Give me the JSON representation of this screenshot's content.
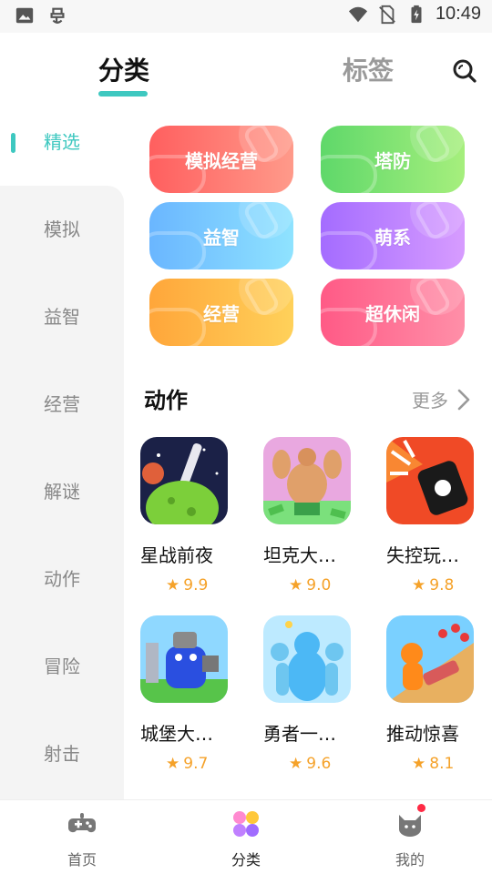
{
  "status_bar": {
    "time": "10:49",
    "left_icons": [
      "image-icon",
      "bug-icon"
    ],
    "right_icons": [
      "wifi-icon",
      "no-sim-icon",
      "battery-icon"
    ]
  },
  "header": {
    "tabs": [
      {
        "label": "分类",
        "active": true
      },
      {
        "label": "标签",
        "active": false
      }
    ],
    "search_icon": "search-icon"
  },
  "side_menu": {
    "items": [
      {
        "label": "精选",
        "active": true
      },
      {
        "label": "模拟",
        "active": false
      },
      {
        "label": "益智",
        "active": false
      },
      {
        "label": "经营",
        "active": false
      },
      {
        "label": "解谜",
        "active": false
      },
      {
        "label": "动作",
        "active": false
      },
      {
        "label": "冒险",
        "active": false
      },
      {
        "label": "射击",
        "active": false
      }
    ]
  },
  "categories": [
    {
      "label": "模拟经营",
      "colors": [
        "#ff5f5f",
        "#ff9a8a"
      ]
    },
    {
      "label": "塔防",
      "colors": [
        "#5fd86a",
        "#a6ef7d"
      ]
    },
    {
      "label": "益智",
      "colors": [
        "#6ab6ff",
        "#8fe3ff"
      ]
    },
    {
      "label": "萌系",
      "colors": [
        "#a46cff",
        "#d79cff"
      ]
    },
    {
      "label": "经营",
      "colors": [
        "#ffa63a",
        "#ffd15a"
      ]
    },
    {
      "label": "超休闲",
      "colors": [
        "#ff5a86",
        "#ff8fa8"
      ]
    }
  ],
  "section": {
    "title": "动作",
    "more_label": "更多"
  },
  "games": [
    {
      "name": "星战前夜",
      "rating": "9.9"
    },
    {
      "name": "坦克大…",
      "rating": "9.0"
    },
    {
      "name": "失控玩…",
      "rating": "9.8"
    },
    {
      "name": "城堡大…",
      "rating": "9.7"
    },
    {
      "name": "勇者一…",
      "rating": "9.6"
    },
    {
      "name": "推动惊喜",
      "rating": "8.1"
    }
  ],
  "bottom_nav": {
    "items": [
      {
        "label": "首页",
        "icon": "gamepad-icon",
        "active": false
      },
      {
        "label": "分类",
        "icon": "category-grid-icon",
        "active": true
      },
      {
        "label": "我的",
        "icon": "cat-profile-icon",
        "active": false,
        "badge": true
      }
    ]
  },
  "accent_color": "#3ec8c0",
  "rating_color": "#f5a22a"
}
